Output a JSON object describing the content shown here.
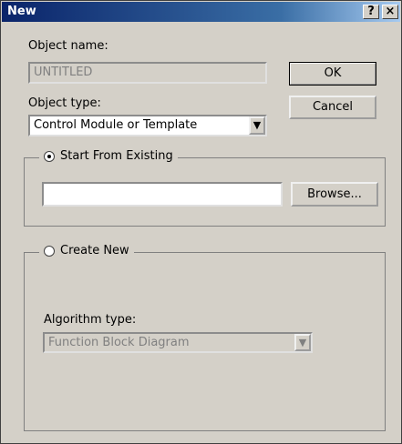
{
  "window": {
    "title": "New",
    "help": "?",
    "close": "×"
  },
  "object_name": {
    "label": "Object name:",
    "value": "UNTITLED"
  },
  "object_type": {
    "label": "Object type:",
    "value": "Control Module or Template"
  },
  "buttons": {
    "ok": "OK",
    "cancel": "Cancel",
    "browse": "Browse..."
  },
  "start_existing": {
    "label": "Start From Existing",
    "selected": true,
    "path": ""
  },
  "create_new": {
    "label": "Create New",
    "selected": false
  },
  "algorithm": {
    "label": "Algorithm type:",
    "value": "Function Block Diagram"
  }
}
